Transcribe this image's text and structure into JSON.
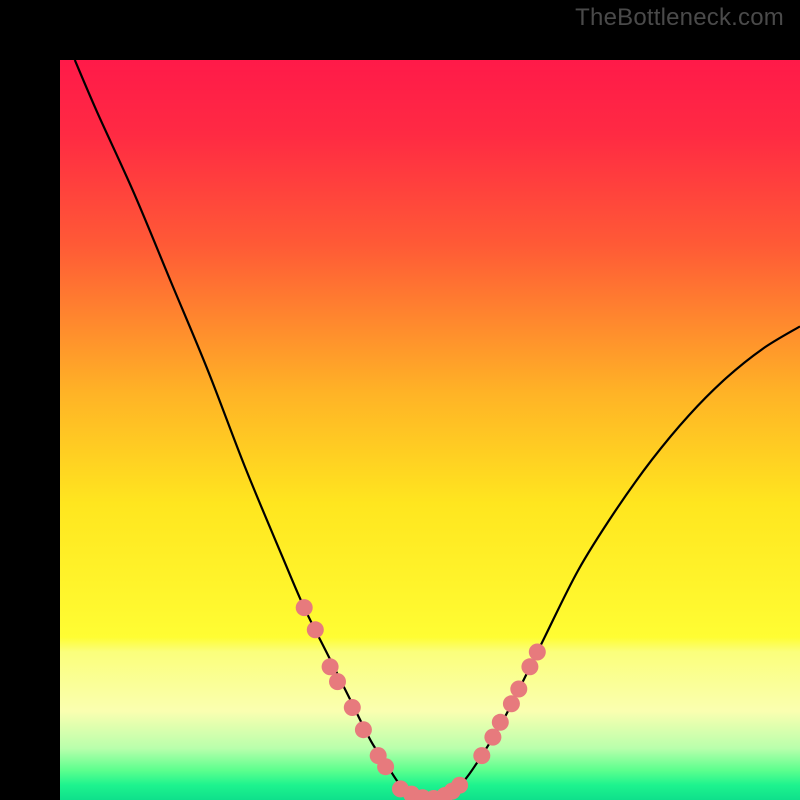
{
  "watermark": "TheBottleneck.com",
  "chart_data": {
    "type": "line",
    "title": "",
    "xlabel": "",
    "ylabel": "",
    "xlim": [
      0,
      100
    ],
    "ylim": [
      0,
      100
    ],
    "gradient_stops": [
      {
        "pos": 0.0,
        "color": "#ff1a49"
      },
      {
        "pos": 0.1,
        "color": "#ff2a43"
      },
      {
        "pos": 0.25,
        "color": "#ff5a36"
      },
      {
        "pos": 0.45,
        "color": "#ffb326"
      },
      {
        "pos": 0.6,
        "color": "#ffe61f"
      },
      {
        "pos": 0.78,
        "color": "#fffd33"
      },
      {
        "pos": 0.8,
        "color": "#fbff7c"
      },
      {
        "pos": 0.88,
        "color": "#faffb0"
      },
      {
        "pos": 0.93,
        "color": "#b9ffac"
      },
      {
        "pos": 0.96,
        "color": "#5cff8e"
      },
      {
        "pos": 0.98,
        "color": "#1df38e"
      },
      {
        "pos": 1.0,
        "color": "#0fe08b"
      }
    ],
    "series": [
      {
        "name": "curve",
        "x": [
          2,
          5,
          10,
          15,
          20,
          25,
          30,
          33,
          36,
          39,
          42,
          44,
          46,
          48,
          50,
          52,
          54,
          56,
          60,
          65,
          70,
          75,
          80,
          85,
          90,
          95,
          100
        ],
        "y": [
          100,
          93,
          82,
          70,
          58,
          45,
          33,
          26,
          20,
          14,
          8,
          5,
          2,
          0.5,
          0,
          0.5,
          2,
          4.5,
          11,
          21,
          31,
          39,
          46,
          52,
          57,
          61,
          64
        ]
      }
    ],
    "markers_left": [
      {
        "x": 33.0,
        "y": 26.0
      },
      {
        "x": 34.5,
        "y": 23.0
      },
      {
        "x": 36.5,
        "y": 18.0
      },
      {
        "x": 37.5,
        "y": 16.0
      },
      {
        "x": 39.5,
        "y": 12.5
      },
      {
        "x": 41.0,
        "y": 9.5
      },
      {
        "x": 43.0,
        "y": 6.0
      },
      {
        "x": 44.0,
        "y": 4.5
      }
    ],
    "markers_bottom": [
      {
        "x": 46.0,
        "y": 1.5
      },
      {
        "x": 47.5,
        "y": 0.8
      },
      {
        "x": 49.0,
        "y": 0.3
      },
      {
        "x": 50.5,
        "y": 0.2
      },
      {
        "x": 52.0,
        "y": 0.6
      },
      {
        "x": 53.0,
        "y": 1.2
      },
      {
        "x": 54.0,
        "y": 2.0
      }
    ],
    "markers_right": [
      {
        "x": 57.0,
        "y": 6.0
      },
      {
        "x": 58.5,
        "y": 8.5
      },
      {
        "x": 59.5,
        "y": 10.5
      },
      {
        "x": 61.0,
        "y": 13.0
      },
      {
        "x": 62.0,
        "y": 15.0
      },
      {
        "x": 63.5,
        "y": 18.0
      },
      {
        "x": 64.5,
        "y": 20.0
      }
    ],
    "marker_color": "#e77a7d",
    "curve_color": "#000000"
  }
}
